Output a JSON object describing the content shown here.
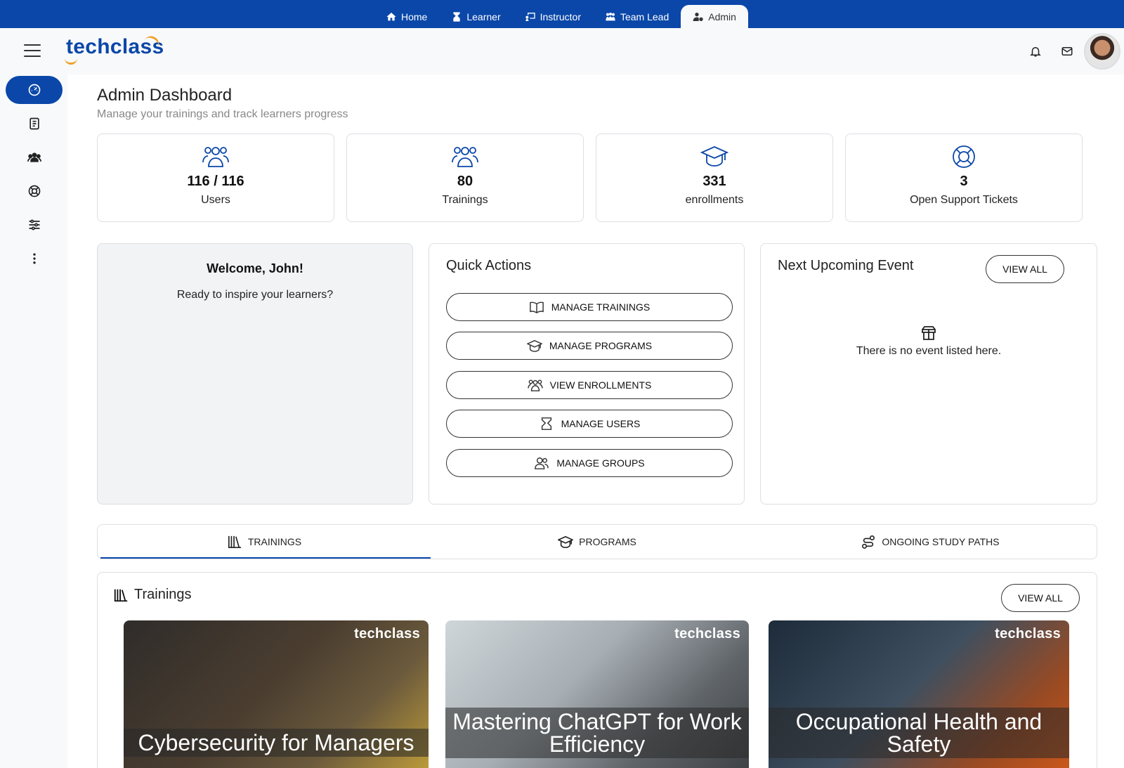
{
  "roles": [
    {
      "label": "Home",
      "icon": "home-icon"
    },
    {
      "label": "Learner",
      "icon": "learner-icon"
    },
    {
      "label": "Instructor",
      "icon": "instructor-icon"
    },
    {
      "label": "Team Lead",
      "icon": "team-lead-icon"
    },
    {
      "label": "Admin",
      "icon": "admin-icon",
      "active": true
    }
  ],
  "header": {
    "logo_text": "techclass",
    "icons": [
      "menu-icon",
      "bell-icon",
      "mail-icon"
    ]
  },
  "sidebar": {
    "items": [
      "dashboard-icon",
      "book-icon",
      "users-icon",
      "support-icon",
      "settings-sliders-icon",
      "more-vertical-icon"
    ]
  },
  "page": {
    "title": "Admin Dashboard",
    "subtitle": "Manage your trainings and track learners progress"
  },
  "stats": [
    {
      "value": "116 / 116",
      "label": "Users",
      "icon": "users-icon"
    },
    {
      "value": "80",
      "label": "Trainings",
      "icon": "users-icon"
    },
    {
      "value": "331",
      "label": "enrollments",
      "icon": "graduation-cap-icon"
    },
    {
      "value": "3",
      "label": "Open Support Tickets",
      "icon": "lifebuoy-icon"
    }
  ],
  "welcome": {
    "title": "Welcome, John!",
    "text": "Ready to inspire your learners?"
  },
  "quick_actions": {
    "title": "Quick Actions",
    "buttons": [
      {
        "label": "MANAGE TRAININGS",
        "icon": "book-open-icon"
      },
      {
        "label": "MANAGE PROGRAMS",
        "icon": "graduation-cap-icon"
      },
      {
        "label": "VIEW ENROLLMENTS",
        "icon": "users-icon"
      },
      {
        "label": "MANAGE USERS",
        "icon": "manage-users-icon"
      },
      {
        "label": "MANAGE GROUPS",
        "icon": "group-icon"
      }
    ]
  },
  "event": {
    "title": "Next Upcoming Event",
    "view_all": "VIEW ALL",
    "empty_text": "There is no event listed here."
  },
  "tabs": [
    {
      "label": "TRAININGS",
      "icon": "library-icon",
      "active": true
    },
    {
      "label": "PROGRAMS",
      "icon": "graduation-cap-icon"
    },
    {
      "label": "ONGOING STUDY PATHS",
      "icon": "route-icon"
    }
  ],
  "trainings": {
    "title": "Trainings",
    "view_all": "VIEW ALL",
    "cards": [
      {
        "title": "Cybersecurity for Managers",
        "brand": "techclass",
        "colors": [
          "#2f2c2a",
          "#6b5a3c",
          "#c9a53a"
        ]
      },
      {
        "title": "Mastering ChatGPT for Work Efficiency",
        "brand": "techclass",
        "colors": [
          "#cfd6da",
          "#8a9197",
          "#3a3d40"
        ]
      },
      {
        "title": "Occupational Health and Safety",
        "brand": "techclass",
        "colors": [
          "#1d2b3a",
          "#3f4f5f",
          "#d35a1a"
        ]
      }
    ]
  },
  "colors": {
    "brand": "#0a47a9",
    "accent": "#f0a02a"
  }
}
